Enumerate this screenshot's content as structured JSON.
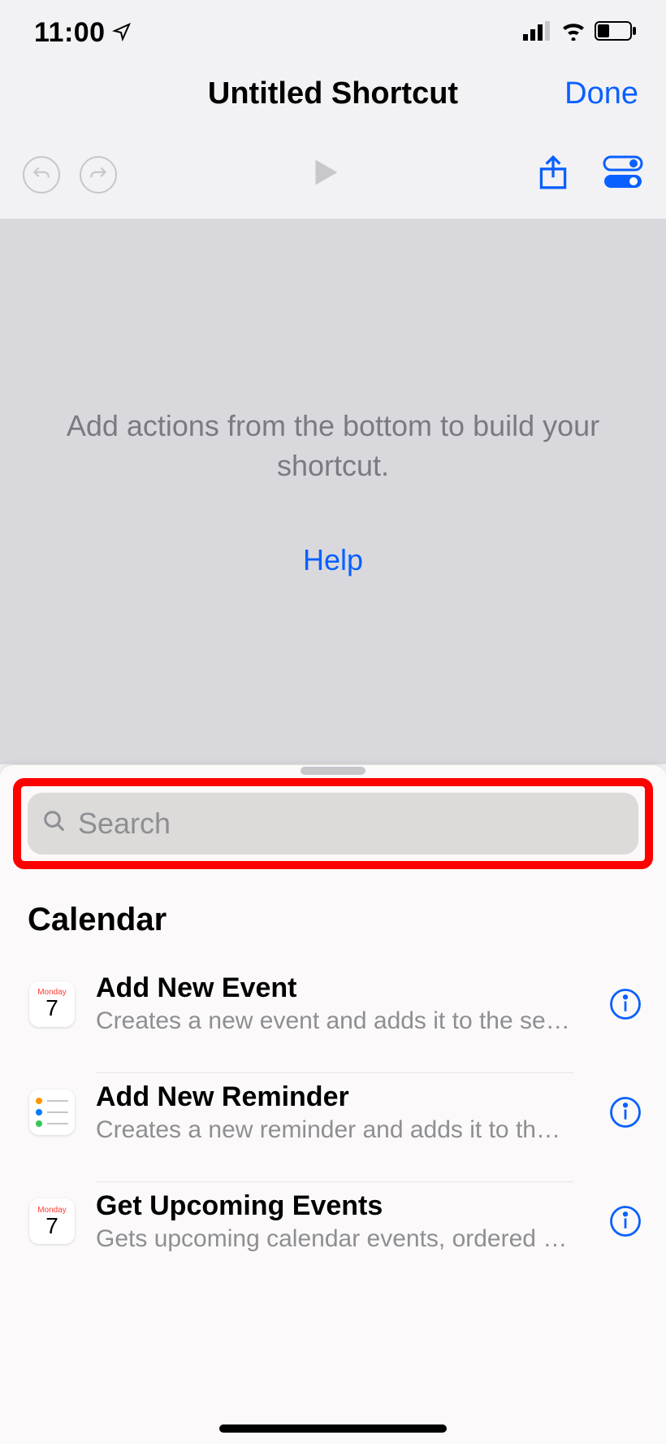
{
  "status": {
    "time": "11:00"
  },
  "header": {
    "title": "Untitled Shortcut",
    "done": "Done"
  },
  "canvas": {
    "hint": "Add actions from the bottom to build your shortcut.",
    "help": "Help"
  },
  "search": {
    "placeholder": "Search"
  },
  "section": {
    "title": "Calendar"
  },
  "calendar_icon": {
    "dow": "Monday",
    "day": "7"
  },
  "actions": [
    {
      "title": "Add New Event",
      "subtitle": "Creates a new event and adds it to the sel…"
    },
    {
      "title": "Add New Reminder",
      "subtitle": "Creates a new reminder and adds it to the…"
    },
    {
      "title": "Get Upcoming Events",
      "subtitle": "Gets upcoming calendar events, ordered fr…"
    }
  ]
}
